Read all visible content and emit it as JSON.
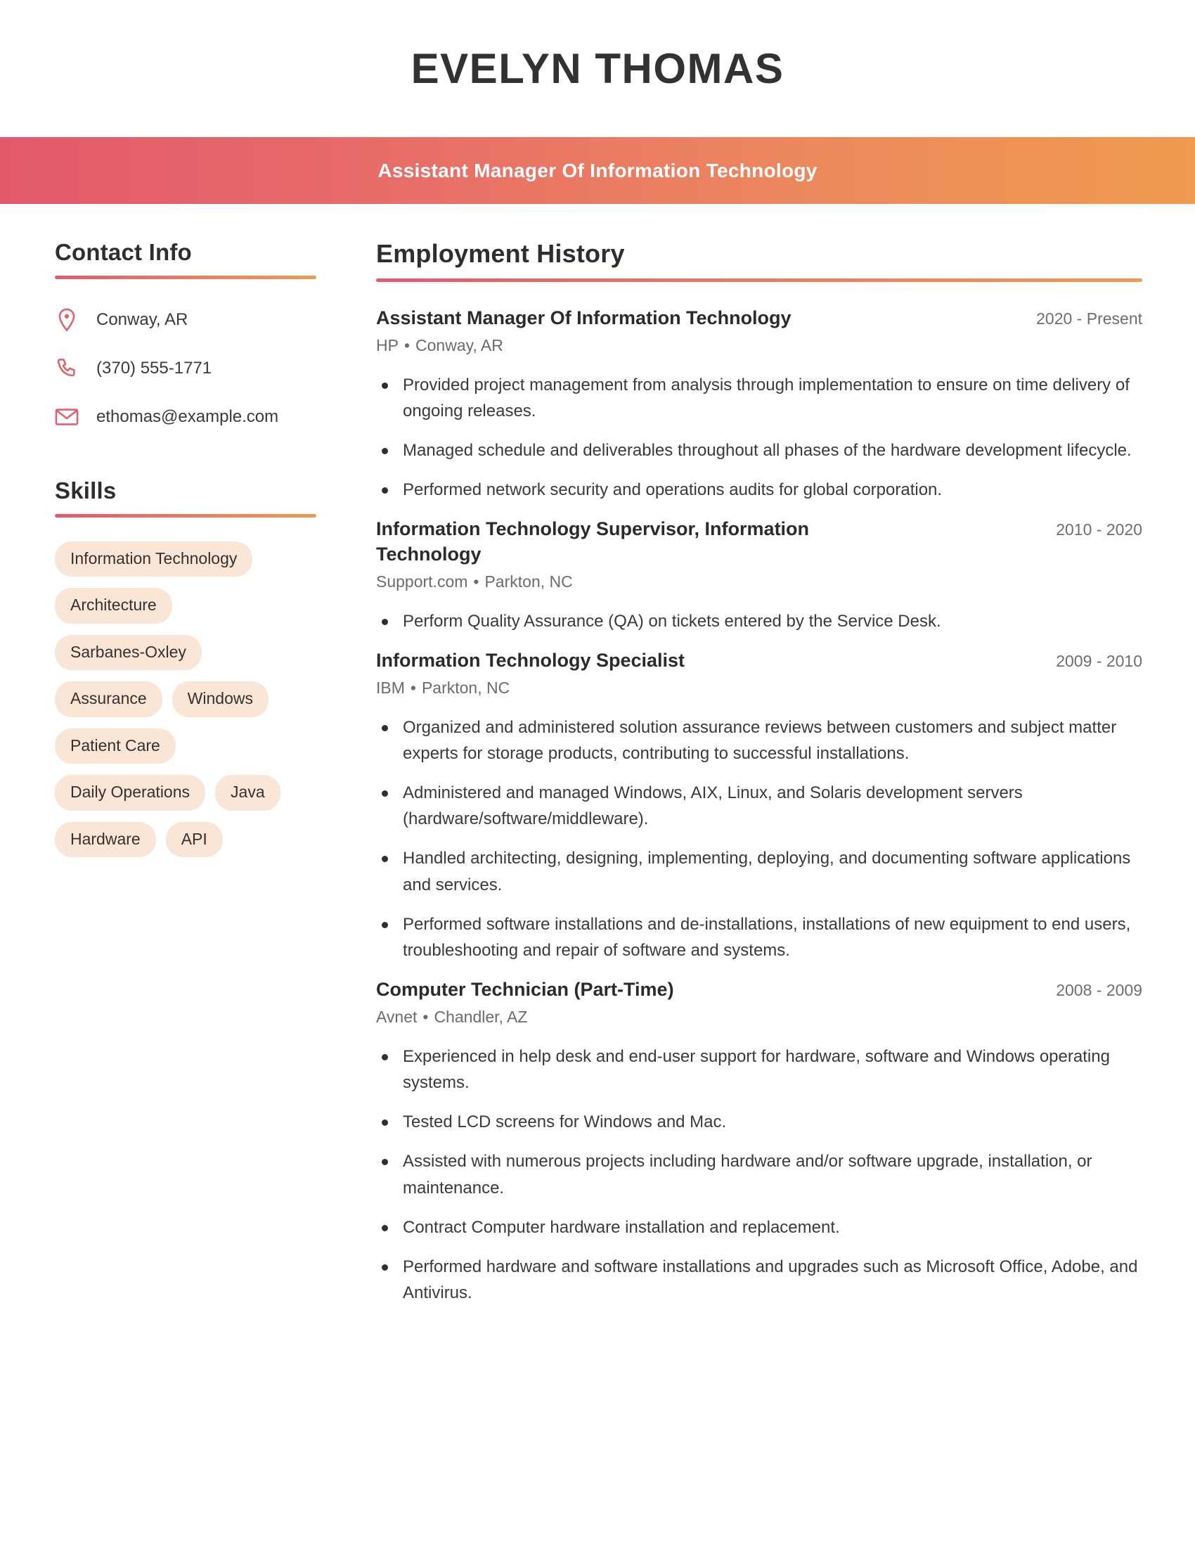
{
  "header": {
    "full_name": "EVELYN THOMAS",
    "job_title": "Assistant Manager Of Information Technology",
    "banner_gradient_start": "#e2596c",
    "banner_gradient_end": "#ef9a4f"
  },
  "sidebar": {
    "contact_heading": "Contact Info",
    "contact_items": [
      {
        "icon": "map-pin-icon",
        "text": "Conway, AR"
      },
      {
        "icon": "phone-icon",
        "text": "(370) 555-1771"
      },
      {
        "icon": "envelope-icon",
        "text": "ethomas@example.com"
      }
    ],
    "skills_heading": "Skills",
    "skills": [
      "Information Technology",
      "Architecture",
      "Sarbanes-Oxley",
      "Assurance",
      "Windows",
      "Patient Care",
      "Daily Operations",
      "Java",
      "Hardware",
      "API"
    ],
    "icon_color": "#e0606f",
    "skill_pill_color": "#fae6d7"
  },
  "main": {
    "employment_heading": "Employment History",
    "jobs": [
      {
        "title": "Assistant Manager Of Information Technology",
        "dates": "2020 - Present",
        "company": "HP",
        "location": "Conway, AR",
        "bullets": [
          "Provided project management from analysis through implementation to ensure on time delivery of ongoing releases.",
          "Managed schedule and deliverables throughout all phases of the hardware development lifecycle.",
          "Performed network security and operations audits for global corporation."
        ]
      },
      {
        "title": "Information Technology Supervisor, Information Technology",
        "dates": "2010 - 2020",
        "company": "Support.com",
        "location": "Parkton, NC",
        "bullets": [
          "Perform Quality Assurance (QA) on tickets entered by the Service Desk."
        ]
      },
      {
        "title": "Information Technology Specialist",
        "dates": "2009 - 2010",
        "company": "IBM",
        "location": "Parkton, NC",
        "bullets": [
          "Organized and administered solution assurance reviews between customers and subject matter experts for storage products, contributing to successful installations.",
          "Administered and managed Windows, AIX, Linux, and Solaris development servers (hardware/software/middleware).",
          "Handled architecting, designing, implementing, deploying, and documenting software applications and services.",
          "Performed software installations and de-installations, installations of new equipment to end users, troubleshooting and repair of software and systems."
        ]
      },
      {
        "title": "Computer Technician (Part-Time)",
        "dates": "2008 - 2009",
        "company": "Avnet",
        "location": "Chandler, AZ",
        "bullets": [
          "Experienced in help desk and end-user support for hardware, software and Windows operating systems.",
          "Tested LCD screens for Windows and Mac.",
          "Assisted with numerous projects including hardware and/or software upgrade, installation, or maintenance.",
          "Contract Computer hardware installation and replacement.",
          "Performed hardware and software installations and upgrades such as Microsoft Office, Adobe, and Antivirus."
        ]
      }
    ],
    "separator": "•"
  }
}
